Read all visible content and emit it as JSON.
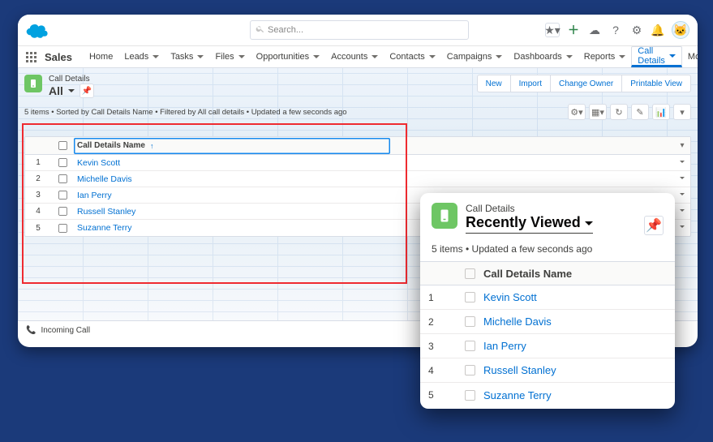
{
  "search": {
    "placeholder": "Search..."
  },
  "app_name": "Sales",
  "nav": {
    "items": [
      "Home",
      "Leads",
      "Tasks",
      "Files",
      "Opportunities",
      "Accounts",
      "Contacts",
      "Campaigns",
      "Dashboards",
      "Reports"
    ],
    "active": "Call Details",
    "more": "More"
  },
  "list": {
    "object_label": "Call Details",
    "title": "All",
    "sort_info": "5 items • Sorted by Call Details Name • Filtered by All call details • Updated a few seconds ago",
    "column_header": "Call Details Name",
    "rows": [
      {
        "name": "Kevin Scott"
      },
      {
        "name": "Michelle Davis"
      },
      {
        "name": "Ian Perry"
      },
      {
        "name": "Russell Stanley"
      },
      {
        "name": "Suzanne Terry"
      }
    ]
  },
  "actions": {
    "new": "New",
    "import": "Import",
    "change_owner": "Change Owner",
    "printable": "Printable View"
  },
  "bottom": {
    "label": "Incoming Call"
  },
  "overlay": {
    "object_label": "Call Details",
    "title": "Recently Viewed",
    "info": "5 items • Updated a few seconds ago",
    "column_header": "Call Details Name",
    "rows": [
      {
        "name": "Kevin Scott"
      },
      {
        "name": "Michelle Davis"
      },
      {
        "name": "Ian Perry"
      },
      {
        "name": "Russell Stanley"
      },
      {
        "name": "Suzanne Terry"
      }
    ]
  }
}
